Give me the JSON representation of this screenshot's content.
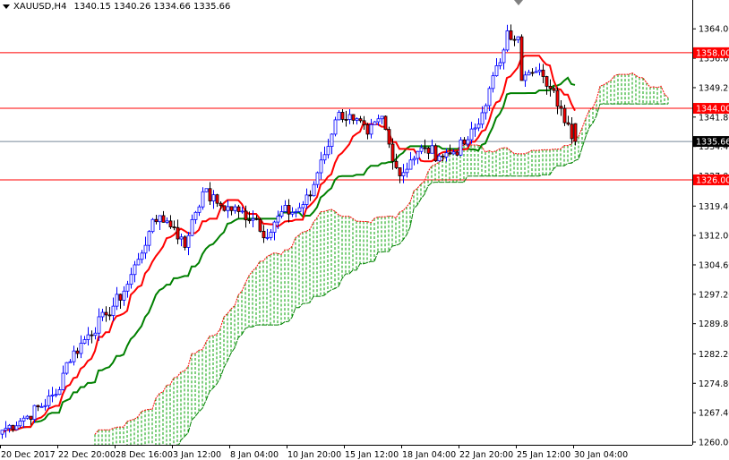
{
  "header": {
    "symbol": "XAUUSD,H4",
    "ohlc": "1340.15 1340.26 1334.66 1335.66"
  },
  "colors": {
    "bull": "#0000ff",
    "bear": "#ff0000",
    "tenkan": "#ff0000",
    "kijun": "#008000",
    "cloud": "#00a000",
    "level": "#ff0000",
    "price_line": "#778899"
  },
  "chart_data": {
    "type": "candlestick",
    "title": "XAUUSD,H4",
    "ylim": [
      1260.0,
      1364.0
    ],
    "yticks": [
      "1364.00",
      "1356.60",
      "1349.20",
      "1341.80",
      "1334.40",
      "1327.00",
      "1319.40",
      "1312.00",
      "1304.60",
      "1297.20",
      "1289.80",
      "1282.20",
      "1274.80",
      "1267.40",
      "1260.00"
    ],
    "xticks": [
      "20 Dec 2017",
      "22 Dec 20:00",
      "28 Dec 16:00",
      "3 Jan 12:00",
      "8 Jan 04:00",
      "10 Jan 20:00",
      "15 Jan 12:00",
      "18 Jan 04:00",
      "22 Jan 20:00",
      "25 Jan 12:00",
      "30 Jan 04:00"
    ],
    "bars_total": 161,
    "close_waypoints": [
      [
        0,
        1263
      ],
      [
        7,
        1266.5
      ],
      [
        15,
        1272
      ],
      [
        18,
        1280
      ],
      [
        24,
        1287
      ],
      [
        29,
        1292
      ],
      [
        34,
        1298
      ],
      [
        38,
        1306
      ],
      [
        41,
        1313
      ],
      [
        44,
        1317
      ],
      [
        48,
        1314
      ],
      [
        51,
        1309
      ],
      [
        53,
        1316
      ],
      [
        56,
        1323
      ],
      [
        61,
        1319.5
      ],
      [
        66,
        1318
      ],
      [
        71,
        1316
      ],
      [
        74,
        1311.5
      ],
      [
        78,
        1318
      ],
      [
        82,
        1318
      ],
      [
        86,
        1322
      ],
      [
        89,
        1331
      ],
      [
        92,
        1337.5
      ],
      [
        94,
        1343
      ],
      [
        98,
        1341
      ],
      [
        102,
        1337.5
      ],
      [
        106,
        1342
      ],
      [
        108,
        1335
      ],
      [
        111,
        1327
      ],
      [
        114,
        1331
      ],
      [
        118,
        1334
      ],
      [
        122,
        1332
      ],
      [
        126,
        1333
      ],
      [
        129,
        1335
      ],
      [
        133,
        1340
      ],
      [
        136,
        1349
      ],
      [
        139,
        1355.5
      ],
      [
        141,
        1363.5
      ],
      [
        144,
        1362
      ],
      [
        145,
        1351
      ],
      [
        148,
        1353
      ],
      [
        151,
        1352
      ],
      [
        153,
        1349
      ],
      [
        156,
        1344
      ],
      [
        158,
        1340
      ],
      [
        160,
        1335.66
      ]
    ],
    "levels": [
      {
        "price": 1358.0,
        "label": "1358.00"
      },
      {
        "price": 1344.0,
        "label": "1344.00"
      },
      {
        "price": 1326.0,
        "label": "1326.00"
      }
    ],
    "current_price": {
      "price": 1335.66,
      "label": "1335.66"
    },
    "indicators": [
      "Ichimoku (9,26,52)"
    ]
  }
}
